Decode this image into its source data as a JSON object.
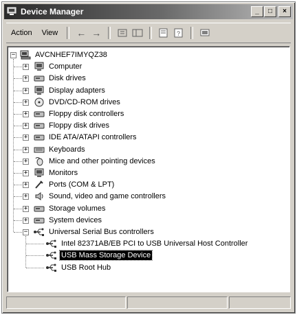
{
  "window": {
    "title": "Device Manager"
  },
  "menu": {
    "action": "Action",
    "view": "View"
  },
  "tree": {
    "root": "AVCNHEF7IMYQZ38",
    "categories": [
      {
        "label": "Computer",
        "icon": "computer-icon"
      },
      {
        "label": "Disk drives",
        "icon": "disk-drive-icon"
      },
      {
        "label": "Display adapters",
        "icon": "display-adapter-icon"
      },
      {
        "label": "DVD/CD-ROM drives",
        "icon": "cdrom-icon"
      },
      {
        "label": "Floppy disk controllers",
        "icon": "floppy-controller-icon"
      },
      {
        "label": "Floppy disk drives",
        "icon": "floppy-drive-icon"
      },
      {
        "label": "IDE ATA/ATAPI controllers",
        "icon": "ide-controller-icon"
      },
      {
        "label": "Keyboards",
        "icon": "keyboard-icon"
      },
      {
        "label": "Mice and other pointing devices",
        "icon": "mouse-icon"
      },
      {
        "label": "Monitors",
        "icon": "monitor-icon"
      },
      {
        "label": "Ports (COM & LPT)",
        "icon": "port-icon"
      },
      {
        "label": "Sound, video and game controllers",
        "icon": "sound-icon"
      },
      {
        "label": "Storage volumes",
        "icon": "storage-volume-icon"
      },
      {
        "label": "System devices",
        "icon": "system-device-icon"
      },
      {
        "label": "Universal Serial Bus controllers",
        "icon": "usb-icon"
      }
    ],
    "usb_children": [
      {
        "label": "Intel 82371AB/EB PCI to USB Universal Host Controller",
        "icon": "usb-icon"
      },
      {
        "label": "USB Mass Storage Device",
        "icon": "usb-icon",
        "selected": true
      },
      {
        "label": "USB Root Hub",
        "icon": "usb-icon"
      }
    ]
  },
  "colors": {
    "selection": "#000000",
    "window_face": "#d4d0c8"
  }
}
